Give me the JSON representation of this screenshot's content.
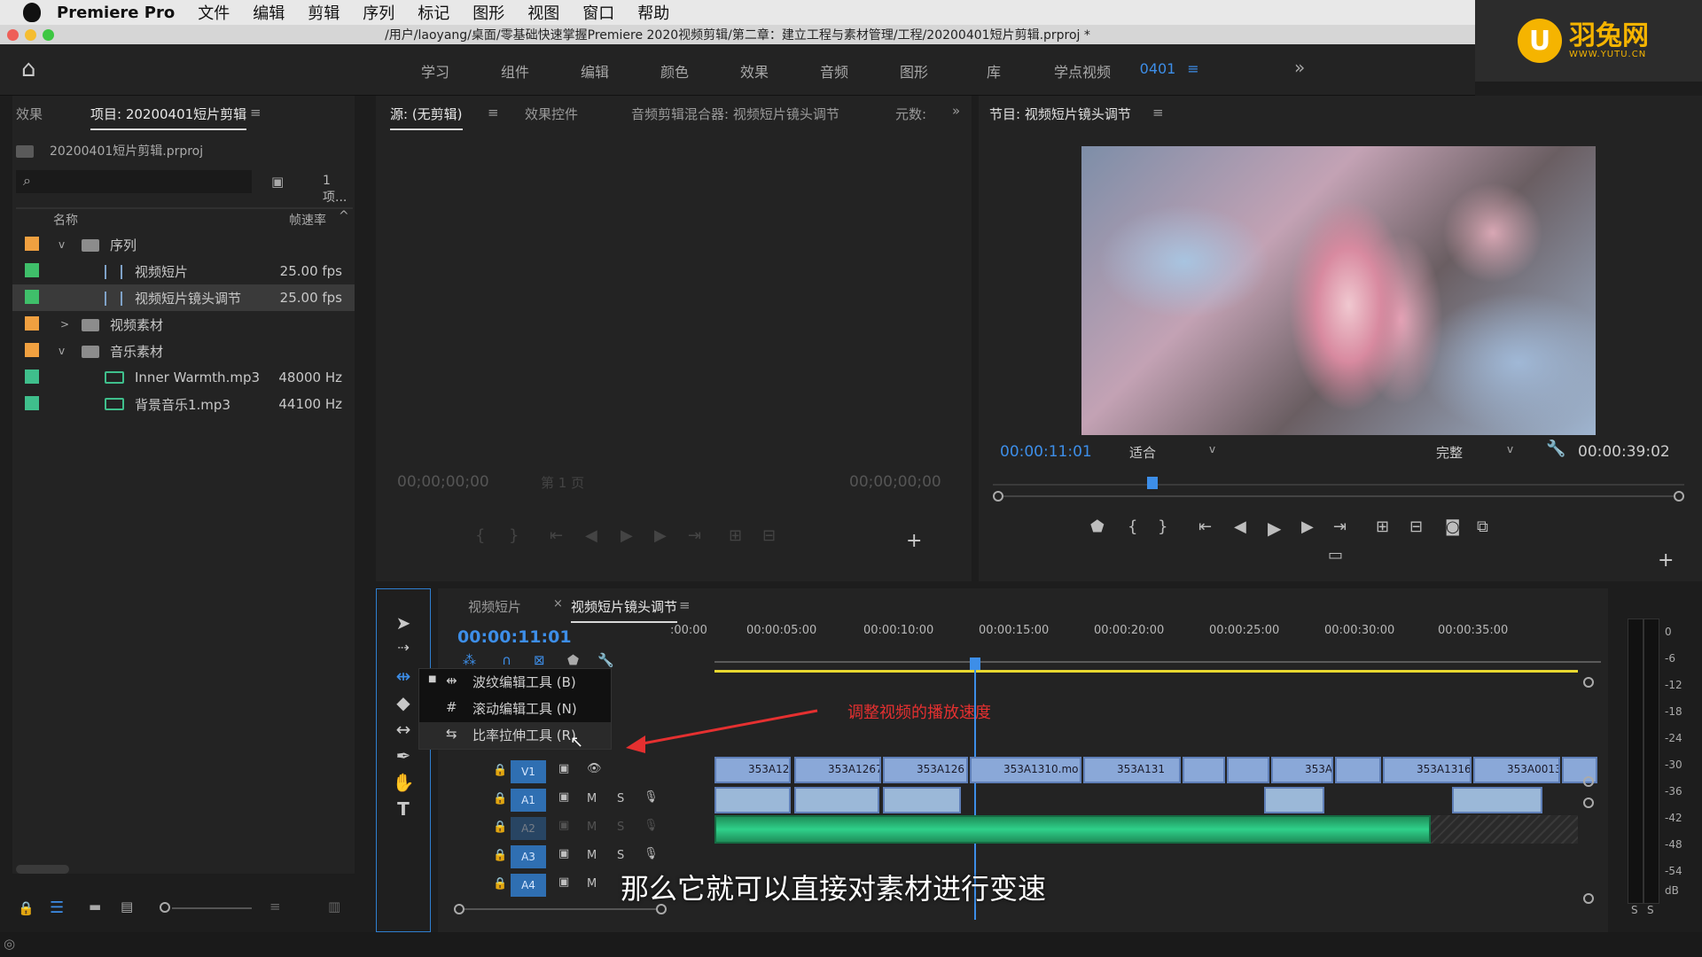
{
  "menubar": {
    "app": "Premiere Pro",
    "items": [
      "文件",
      "编辑",
      "剪辑",
      "序列",
      "标记",
      "图形",
      "视图",
      "窗口",
      "帮助"
    ]
  },
  "titlebar": {
    "path": "/用户/laoyang/桌面/零基础快速掌握Premiere 2020视频剪辑/第二章：建立工程与素材管理/工程/20200401短片剪辑.prproj *"
  },
  "logo": {
    "name": "羽兔网",
    "url_text": "WWW.YUTU.CN"
  },
  "workspace": {
    "tabs": [
      "学习",
      "组件",
      "编辑",
      "颜色",
      "效果",
      "音频",
      "图形",
      "库",
      "学点视频",
      "0401"
    ],
    "active": "0401"
  },
  "project": {
    "tab_effects": "效果",
    "tab_project": "项目: 20200401短片剪辑",
    "file": "20200401短片剪辑.prproj",
    "count": "1 项...",
    "col_name": "名称",
    "col_rate": "帧速率",
    "rows": [
      {
        "name": "序列",
        "rate": "",
        "color": "#f0a040"
      },
      {
        "name": "视频短片",
        "rate": "25.00 fps",
        "color": "#3fbf6a"
      },
      {
        "name": "视频短片镜头调节",
        "rate": "25.00 fps",
        "color": "#3fbf6a"
      },
      {
        "name": "视频素材",
        "rate": "",
        "color": "#f0a040"
      },
      {
        "name": "音乐素材",
        "rate": "",
        "color": "#f0a040"
      },
      {
        "name": "Inner Warmth.mp3",
        "rate": "48000 Hz",
        "color": "#3fbf8c"
      },
      {
        "name": "背景音乐1.mp3",
        "rate": "44100 Hz",
        "color": "#3fbf8c"
      }
    ]
  },
  "source": {
    "tab_source": "源: (无剪辑)",
    "tab_effect_ctrl": "效果控件",
    "tab_audio_mixer": "音频剪辑混合器: 视频短片镜头调节",
    "tab_meta": "元数:",
    "tc_left": "00;00;00;00",
    "tc_right": "00;00;00;00",
    "page": "第 1 页"
  },
  "program": {
    "tab": "节目: 视频短片镜头调节",
    "tc": "00:00:11:01",
    "fit": "适合",
    "quality": "完整",
    "duration": "00:00:39:02"
  },
  "timeline": {
    "tab1": "视频短片",
    "tab2": "视频短片镜头调节",
    "tc": "00:00:11:01",
    "ruler": [
      ":00:00",
      "00:00:05:00",
      "00:00:10:00",
      "00:00:15:00",
      "00:00:20:00",
      "00:00:25:00",
      "00:00:30:00",
      "00:00:35:00"
    ],
    "tracks": [
      "V1",
      "A1",
      "A2",
      "A3",
      "A4"
    ],
    "clips": [
      "353A12",
      "353A1267",
      "353A126",
      "353A1310.mo",
      "353A131",
      "353A",
      "353A1316",
      "353A0013."
    ]
  },
  "popup": {
    "items": [
      "波纹编辑工具 (B)",
      "滚动编辑工具 (N)",
      "比率拉伸工具 (R)"
    ]
  },
  "annotation": "调整视频的播放速度",
  "subtitle": "那么它就可以直接对素材进行变速",
  "meters": {
    "ticks": [
      "0",
      "-6",
      "-12",
      "-18",
      "-24",
      "-30",
      "-36",
      "-42",
      "-48",
      "-54",
      "dB"
    ]
  }
}
